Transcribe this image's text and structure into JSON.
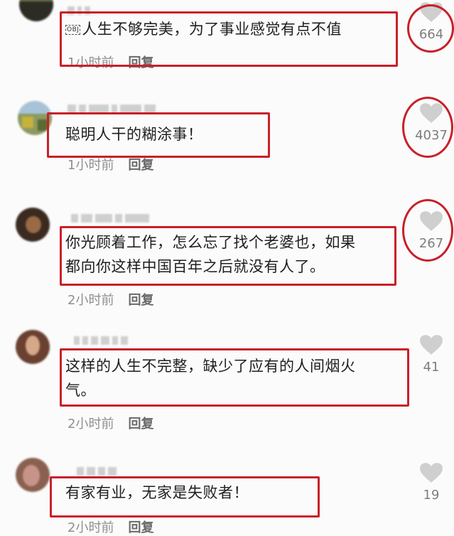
{
  "comments": [
    {
      "obj_glyph": "OBJ",
      "text": "人生不够完美，为了事业感觉有点不值",
      "time": "1小时前",
      "reply": "回复",
      "likes": "664"
    },
    {
      "text": "聪明人干的糊涂事！",
      "time": "1小时前",
      "reply": "回复",
      "likes": "4037"
    },
    {
      "text_line1": "你光顾着工作，怎么忘了找个老婆也，如果",
      "text_line2": "都向你这样中国百年之后就没有人了。",
      "time": "2小时前",
      "reply": "回复",
      "likes": "267"
    },
    {
      "text_line1": "这样的人生不完整，缺少了应有的人间烟火",
      "text_line2": "气。",
      "time": "2小时前",
      "reply": "回复",
      "likes": "41"
    },
    {
      "text": "有家有业，无家是失败者！",
      "time": "2小时前",
      "reply": "回复",
      "likes": "19"
    }
  ],
  "colors": {
    "highlight": "#c8202a",
    "like_icon": "#cfcfcf",
    "text": "#1e1e1e",
    "meta": "#8f8f8f"
  },
  "icons": {
    "like": "heart-icon"
  }
}
